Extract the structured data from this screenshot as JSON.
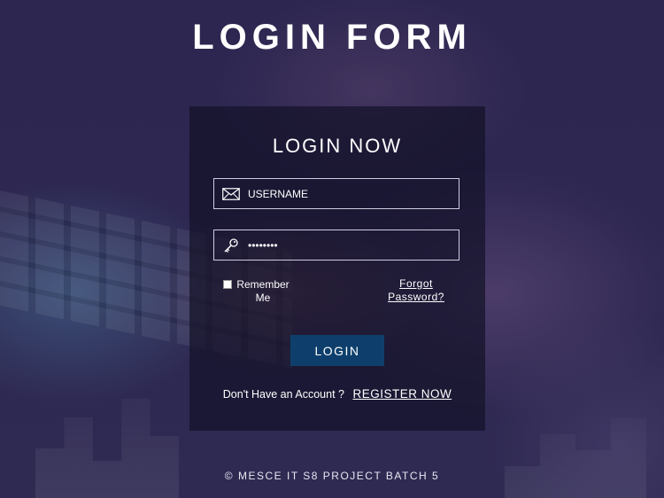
{
  "header": {
    "title": "LOGIN FORM"
  },
  "form": {
    "title": "LOGIN NOW",
    "username": {
      "placeholder": "USERNAME",
      "value": "",
      "icon": "envelope-icon"
    },
    "password": {
      "value": "••••••••",
      "icon": "key-icon"
    },
    "remember_label": "Remember Me",
    "remember_checked": false,
    "forgot_label": "Forgot Password?",
    "login_label": "LOGIN",
    "register_prompt": "Don't Have an Account ?",
    "register_link": "REGISTER NOW"
  },
  "footer": {
    "text": "© MESCE IT S8 PROJECT BATCH 5"
  },
  "colors": {
    "background": "#2a2448",
    "card": "#141228",
    "login_button": "#0e3f6c",
    "text": "#ffffff"
  }
}
